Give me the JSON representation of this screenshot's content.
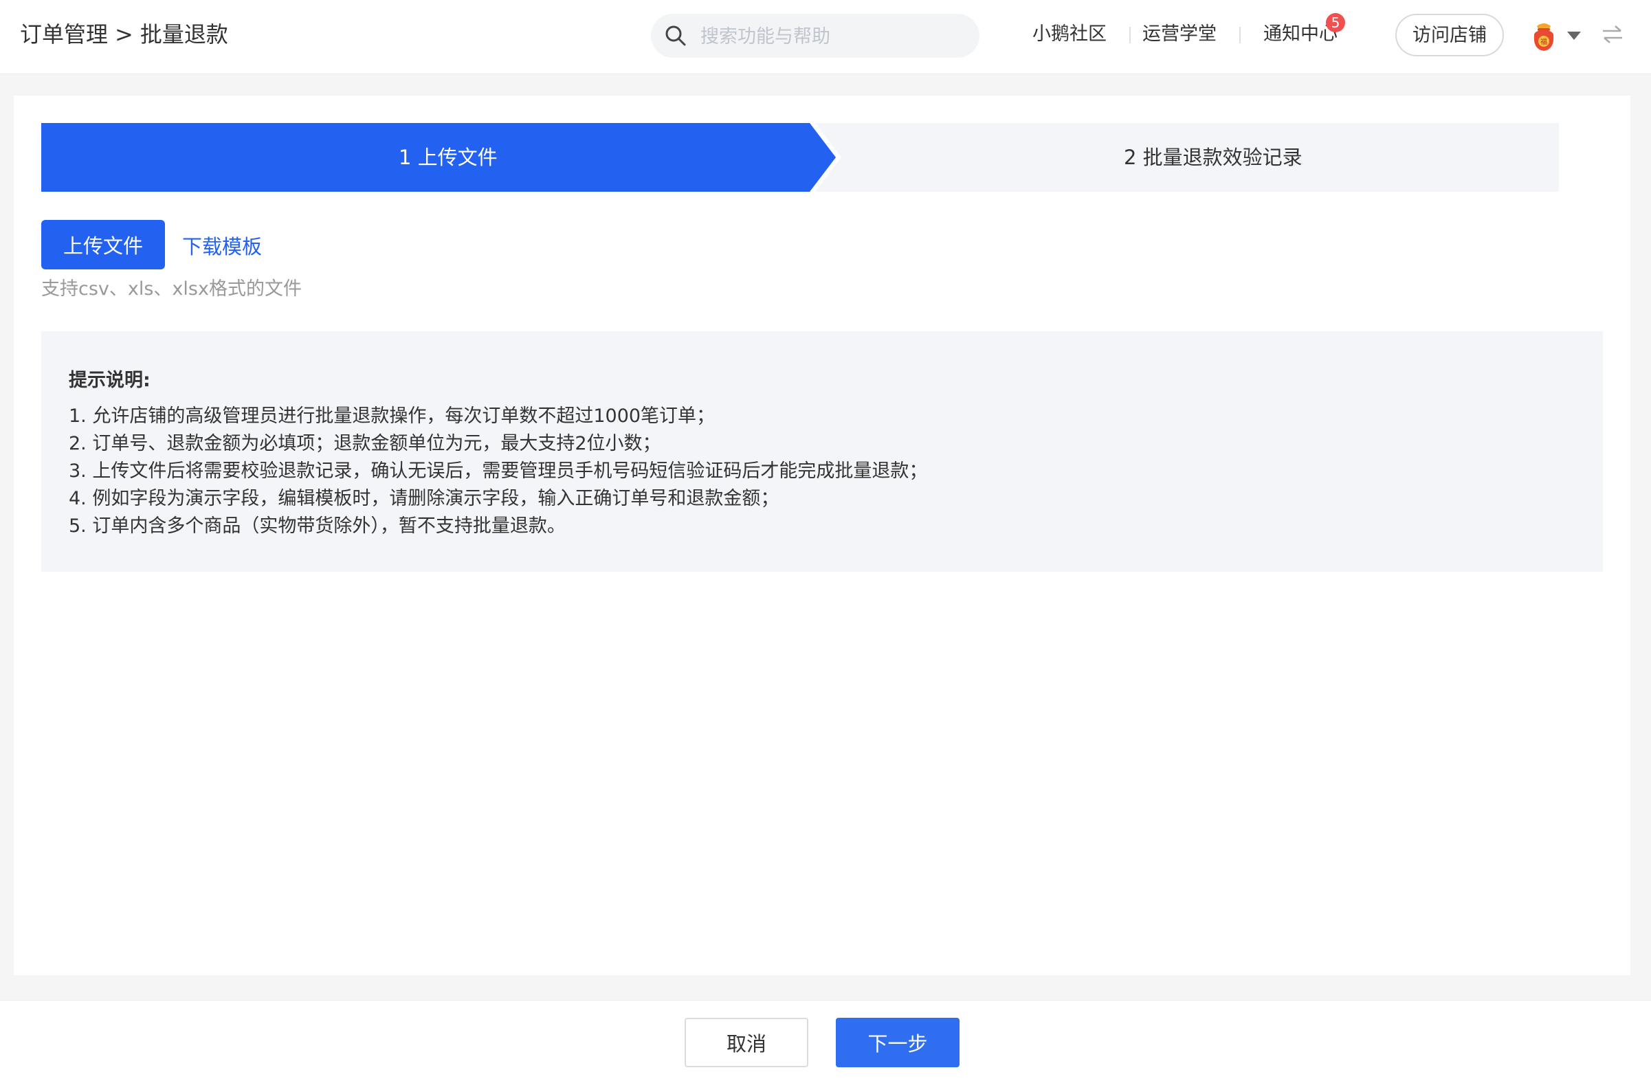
{
  "header": {
    "breadcrumb": {
      "parent": "订单管理",
      "separator": ">",
      "current": "批量退款"
    },
    "search": {
      "placeholder": "搜索功能与帮助",
      "icon": "search-icon"
    },
    "links": {
      "community": "小鹅社区",
      "academy": "运营学堂",
      "notifications": "通知中心"
    },
    "notification_count": "5",
    "visit_store_label": "访问店铺",
    "avatar_icon": "fortune-bag-icon",
    "avatar_glyph": "福",
    "caret_icon": "caret-down-icon",
    "switch_icon": "swap-icon"
  },
  "steps": {
    "items": [
      {
        "label": "1 上传文件",
        "active": true
      },
      {
        "label": "2 批量退款效验记录",
        "active": false
      }
    ]
  },
  "upload": {
    "button_label": "上传文件",
    "template_link": "下载模板",
    "format_hint": "支持csv、xls、xlsx格式的文件"
  },
  "tips": {
    "title": "提示说明:",
    "items": [
      "1. 允许店铺的高级管理员进行批量退款操作，每次订单数不超过1000笔订单；",
      "2. 订单号、退款金额为必填项；退款金额单位为元，最大支持2位小数；",
      "3. 上传文件后将需要校验退款记录，确认无误后，需要管理员手机号码短信验证码后才能完成批量退款；",
      "4. 例如字段为演示字段，编辑模板时，请删除演示字段，输入正确订单号和退款金额；",
      "5. 订单内含多个商品（实物带货除外），暂不支持批量退款。"
    ]
  },
  "footer": {
    "cancel_label": "取消",
    "next_label": "下一步"
  },
  "colors": {
    "primary": "#2362f0",
    "step_inactive_bg": "#f4f5f9",
    "badge": "#f0504f",
    "tips_bg": "#f4f5f9",
    "page_bg": "#f5f5f6"
  }
}
